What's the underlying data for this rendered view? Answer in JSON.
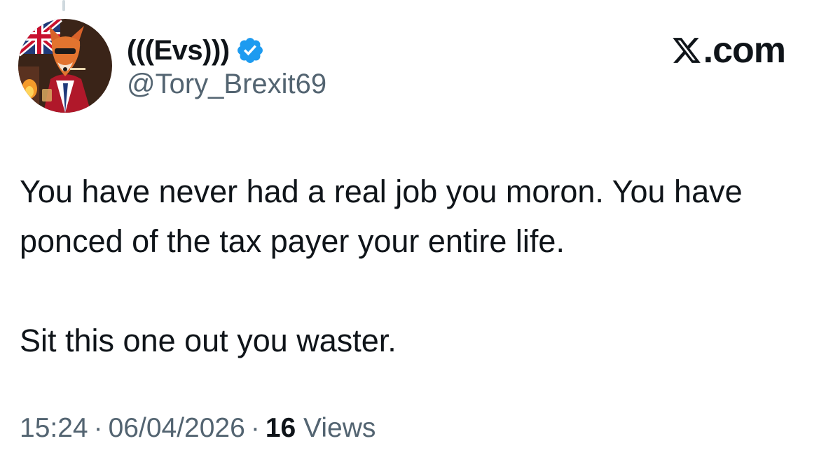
{
  "author": {
    "display_name": "(((Evs)))",
    "handle": "@Tory_Brexit69",
    "verified": true,
    "verified_icon": "verified-badge-icon",
    "verified_color": "#1d9bf0"
  },
  "branding": {
    "logo_icon": "x-logo-icon",
    "text": ".com"
  },
  "tweet": {
    "paragraphs": [
      "You have never had a real job you moron. You have ponced of the tax payer your entire life.",
      "Sit this one out you waster."
    ]
  },
  "meta": {
    "time": "15:24",
    "separator": "·",
    "date": "06/04/2026",
    "views_count": "16",
    "views_label": "Views"
  },
  "colors": {
    "text_primary": "#0f1419",
    "text_secondary": "#536471",
    "background": "#ffffff"
  }
}
